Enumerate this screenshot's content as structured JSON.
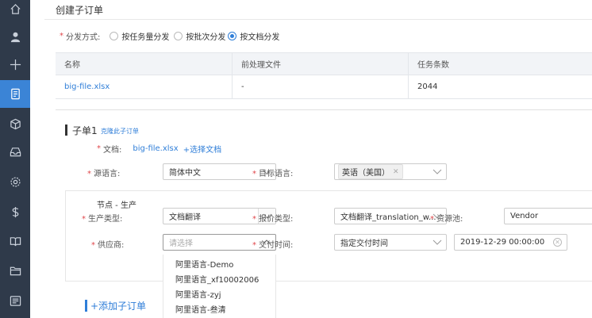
{
  "page": {
    "title": "创建子订单"
  },
  "distribution": {
    "label": "分发方式:",
    "options": [
      {
        "label": "按任务量分发",
        "checked": false
      },
      {
        "label": "按批次分发",
        "checked": false
      },
      {
        "label": "按文档分发",
        "checked": true
      }
    ]
  },
  "file_table": {
    "columns": [
      "名称",
      "前处理文件",
      "任务条数"
    ],
    "rows": [
      {
        "name": "big-file.xlsx",
        "preprocess": "-",
        "task_count": "2044"
      }
    ]
  },
  "sub_order": {
    "title": "子单1",
    "clone_link": "克隆此子订单",
    "doc_label": "文档:",
    "doc_file": "big-file.xlsx",
    "doc_add": "+选择文档",
    "source_lang_label": "源语言:",
    "source_lang_value": "简体中文",
    "target_lang_label": "目标语言:",
    "target_lang_tag": "英语（美国）",
    "node": {
      "title": "节点 - 生产",
      "prod_type_label": "生产类型:",
      "prod_type_value": "文档翻译",
      "quote_type_label": "报价类型:",
      "quote_type_value": "文档翻译_translation_w...",
      "resource_pool_label": "资源池:",
      "resource_pool_value": "Vendor",
      "supplier_label": "供应商:",
      "supplier_placeholder": "请选择",
      "delivery_label": "交付时间:",
      "delivery_value": "指定交付时间",
      "delivery_datetime": "2019-12-29 00:00:00"
    },
    "supplier_options": [
      "阿里语言-Demo",
      "阿里语言_xf10002006",
      "阿里语言-zyj",
      "阿里语言-叁清"
    ]
  },
  "add_sub_order": "+添加子订单",
  "sidebar": {
    "icons": [
      "home-icon",
      "user-icon",
      "plus-icon",
      "order-icon",
      "cube-icon",
      "inbox-icon",
      "settings-icon",
      "dollar-icon",
      "book-icon",
      "folder-icon",
      "report-icon"
    ],
    "active_index": 3
  },
  "colors": {
    "accent": "#2f7ed8",
    "sidebar": "#2f3a4a",
    "sidebar_active": "#3b84d6",
    "required": "#e0464b"
  }
}
